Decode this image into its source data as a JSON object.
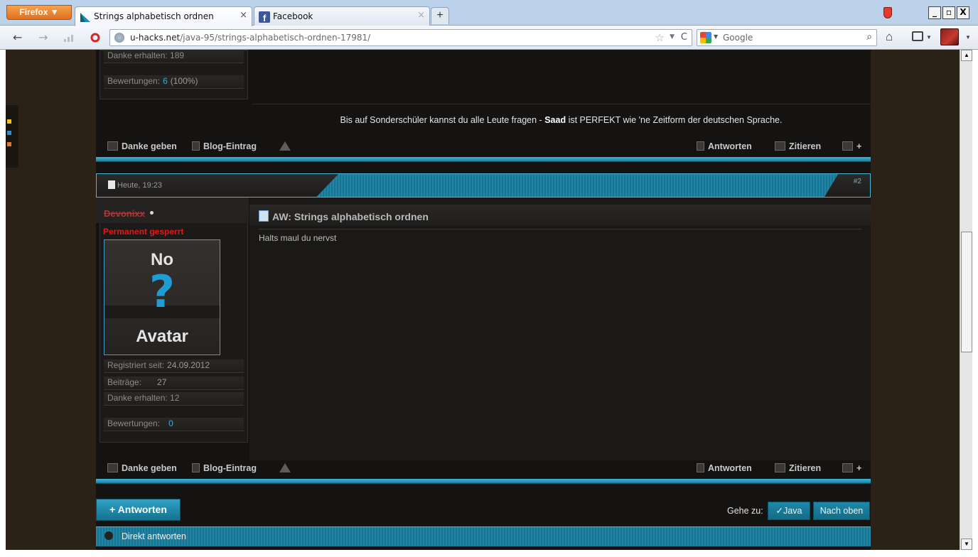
{
  "browser": {
    "menu_button": "Firefox ▼",
    "tabs": [
      {
        "title": "Strings alphabetisch ordnen",
        "close": "×"
      },
      {
        "title": "Facebook",
        "close": "×"
      }
    ],
    "new_tab": "+",
    "window_buttons": [
      "_",
      "▫",
      "X"
    ],
    "url_host": "u-hacks.net",
    "url_path": "/java-95/strings-alphabetisch-ordnen-17981/",
    "search_placeholder": "Google",
    "nav": {
      "back": "←",
      "forward": "→",
      "reload": "C",
      "star": "☆",
      "home": "⌂",
      "search": "⌕"
    }
  },
  "post1": {
    "stats": {
      "thanks_received": "Danke erhalten: 189",
      "ratings_label": "Bewertungen:",
      "ratings_value": "6",
      "ratings_percent": "(100%)"
    },
    "signature_before": "Bis auf Sonderschüler kannst du alle Leute fragen -",
    "signature_bold": "Saad",
    "signature_after": "ist PERFEKT wie 'ne Zeitform der deutschen Sprache."
  },
  "actions": {
    "thanks": "Danke geben",
    "blog": "Blog-Eintrag",
    "reply": "Antworten",
    "quote": "Zitieren",
    "multiquote": "+"
  },
  "post2": {
    "date": "Heute, 19:23",
    "number": "#2",
    "username": "Devonixx",
    "user_status": "Permanent gesperrt",
    "avatar_top": "No",
    "avatar_mark": "?",
    "avatar_bottom": "Avatar",
    "stats": {
      "registered_label": "Registriert seit:",
      "registered_value": "24.09.2012",
      "posts_label": "Beiträge:",
      "posts_value": "27",
      "thanks_received": "Danke erhalten: 12",
      "ratings_label": "Bewertungen:",
      "ratings_value": "0"
    },
    "title": "AW: Strings alphabetisch ordnen",
    "text": "Halts maul du nervst"
  },
  "footer": {
    "reply_button": "+ Antworten",
    "goto_label": "Gehe zu:",
    "goto_java": "✓Java",
    "goto_top": "Nach oben",
    "direct_reply": "Direkt antworten"
  },
  "colors": {
    "accent_blue": "#1f86a6",
    "page_bg": "#2b2116",
    "forum_bg": "#141312",
    "banned_red": "#e21818"
  }
}
